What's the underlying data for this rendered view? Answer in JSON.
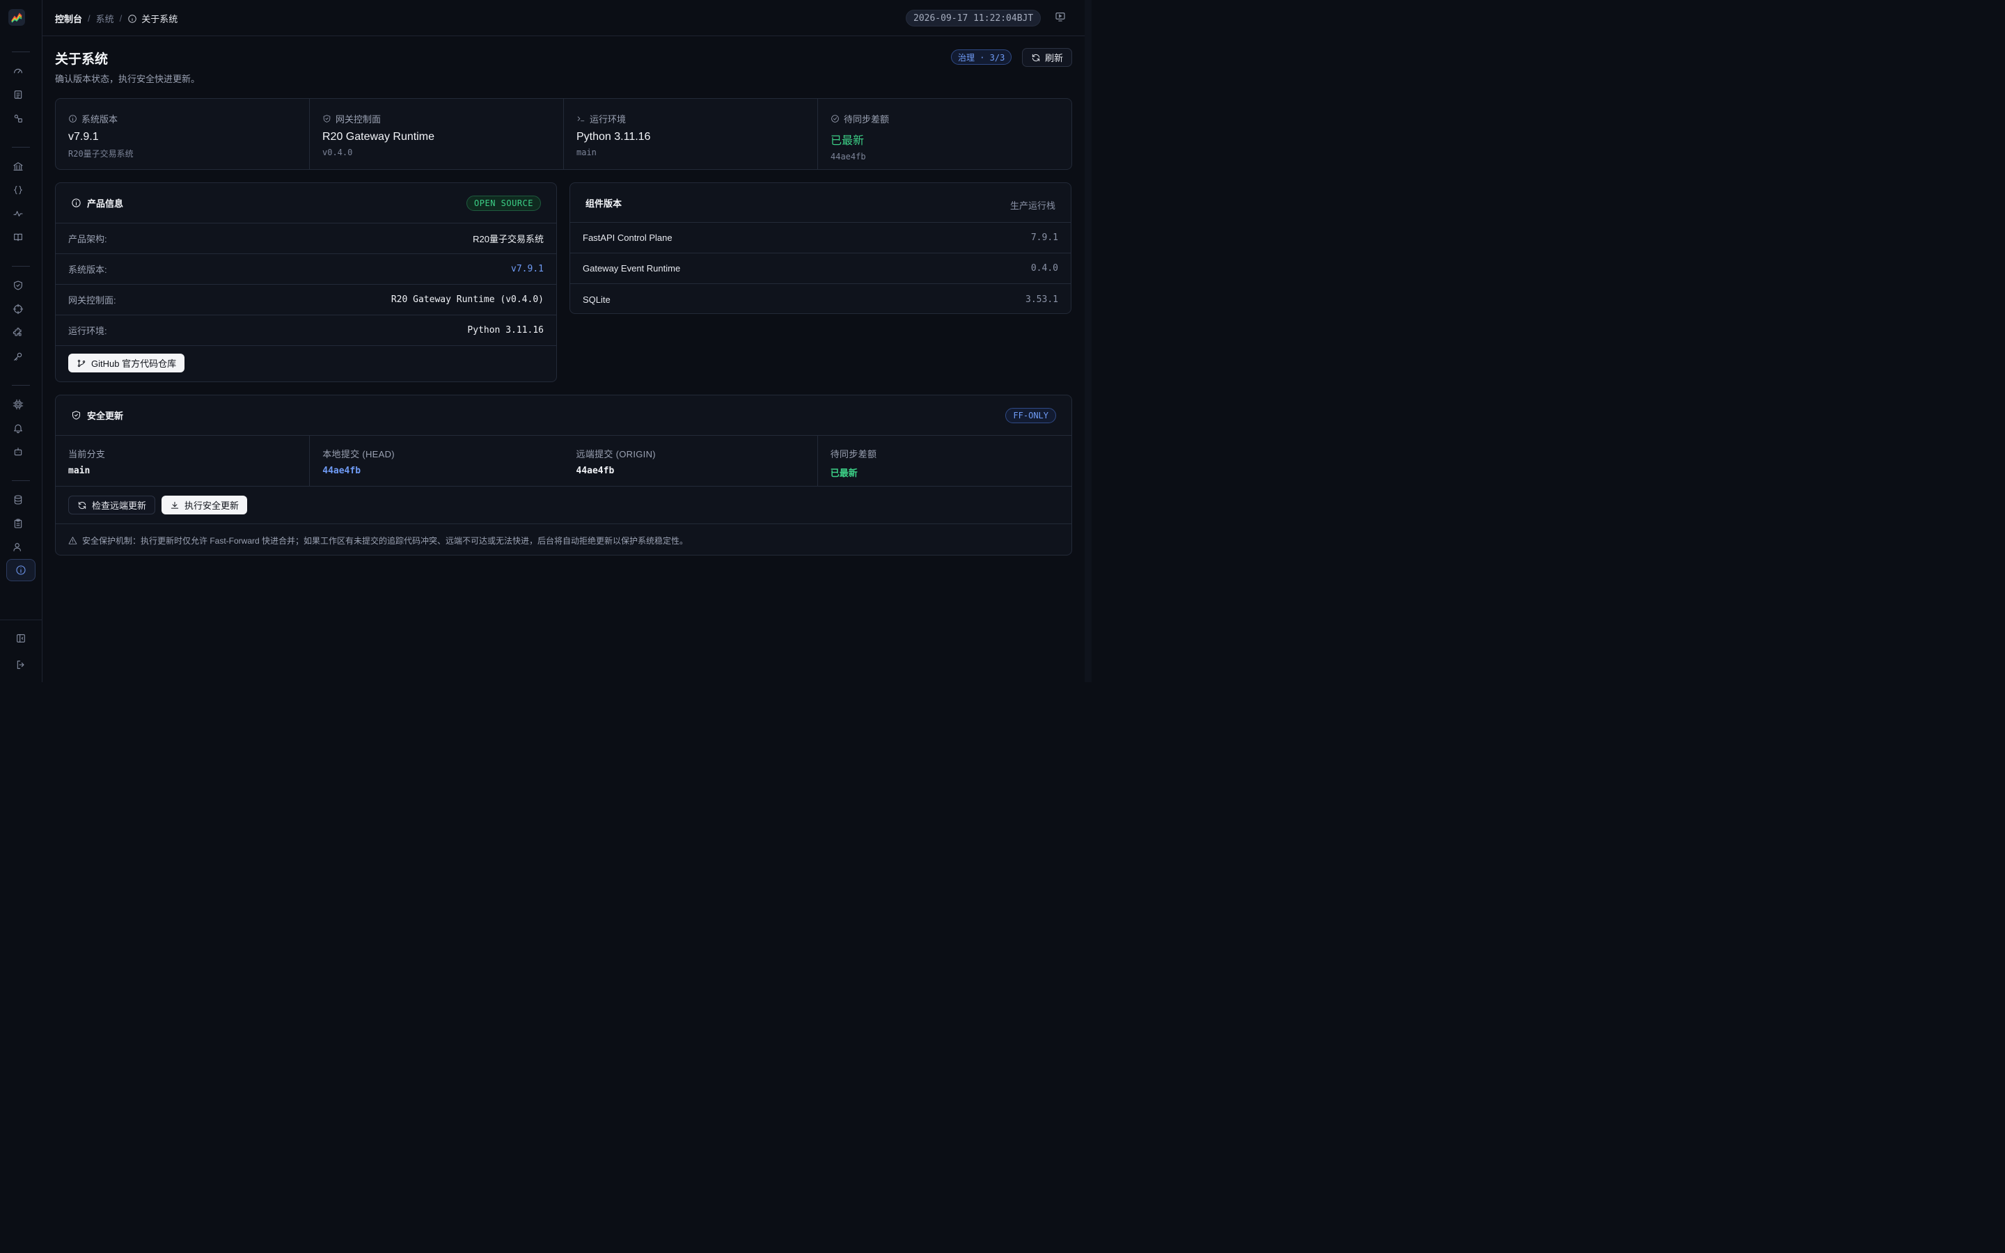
{
  "breadcrumb": {
    "root": "控制台",
    "section": "系统",
    "current": "关于系统"
  },
  "clock": "2026-09-17 11:22:04BJT",
  "header": {
    "title": "关于系统",
    "subtitle": "确认版本状态，执行安全快进更新。",
    "governance_badge": "治理 · 3/3",
    "refresh_label": "刷新"
  },
  "stats": [
    {
      "label": "系统版本",
      "value": "v7.9.1",
      "sub": "R20量子交易系统",
      "icon": "info-icon"
    },
    {
      "label": "网关控制面",
      "value": "R20 Gateway Runtime",
      "sub": "v0.4.0",
      "icon": "shield-icon"
    },
    {
      "label": "运行环境",
      "value": "Python 3.11.16",
      "sub": "main",
      "icon": "terminal-icon"
    },
    {
      "label": "待同步差额",
      "value": "已最新",
      "sub": "44ae4fb",
      "icon": "check-circle-icon"
    }
  ],
  "product": {
    "title": "产品信息",
    "tag": "OPEN SOURCE",
    "rows": [
      {
        "key": "产品架构:",
        "value": "R20量子交易系统"
      },
      {
        "key": "系统版本:",
        "value": "v7.9.1"
      },
      {
        "key": "网关控制面:",
        "value": "R20 Gateway Runtime (v0.4.0)"
      },
      {
        "key": "运行环境:",
        "value": "Python 3.11.16"
      }
    ],
    "github_label": "GitHub 官方代码仓库"
  },
  "components": {
    "title": "组件版本",
    "right_label": "生产运行栈",
    "rows": [
      {
        "name": "FastAPI Control Plane",
        "version": "7.9.1"
      },
      {
        "name": "Gateway Event Runtime",
        "version": "0.4.0"
      },
      {
        "name": "SQLite",
        "version": "3.53.1"
      }
    ]
  },
  "security": {
    "title": "安全更新",
    "tag": "FF-ONLY",
    "cells": [
      {
        "label": "当前分支",
        "value": "main"
      },
      {
        "label": "本地提交 (HEAD)",
        "value": "44ae4fb"
      },
      {
        "label": "远端提交 (ORIGIN)",
        "value": "44ae4fb"
      },
      {
        "label": "待同步差额",
        "value": "已最新"
      }
    ],
    "check_label": "检查远端更新",
    "execute_label": "执行安全更新",
    "warning": "安全保护机制：执行更新时仅允许 Fast-Forward 快进合并；如果工作区有未提交的追踪代码冲突、远端不可达或无法快进，后台将自动拒绝更新以保护系统稳定性。"
  },
  "colors": {
    "accent": "#6f9bf5",
    "success": "#3ccf86",
    "background": "#0b0e15"
  }
}
